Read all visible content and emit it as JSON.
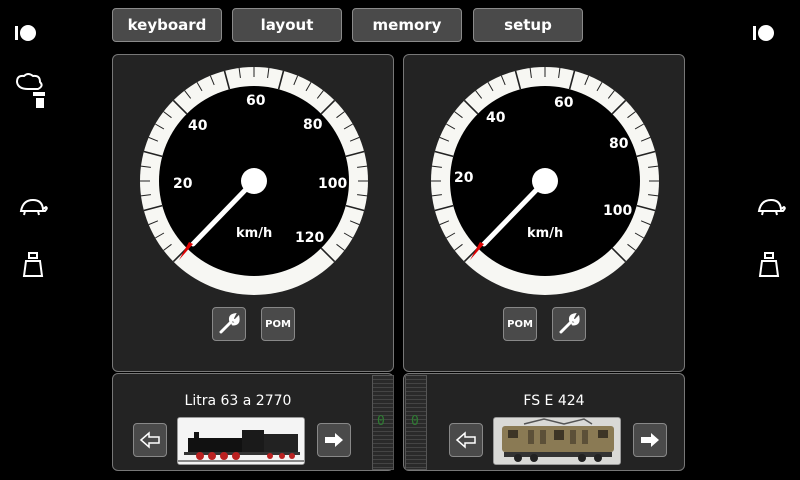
{
  "toolbar": {
    "buttons": [
      {
        "label": "keyboard"
      },
      {
        "label": "layout"
      },
      {
        "label": "memory"
      },
      {
        "label": "setup"
      }
    ]
  },
  "left_side_icons": [
    "power-icon",
    "smoke-icon",
    "turtle-icon",
    "weight-icon"
  ],
  "right_side_icons": [
    "power-icon",
    "turtle-icon",
    "weight-icon"
  ],
  "throttles": [
    {
      "unit": "km/h",
      "speed": 0,
      "tick_labels": [
        "20",
        "40",
        "60",
        "80",
        "100",
        "120"
      ],
      "buttons": [
        "wrench-icon",
        "POM"
      ],
      "loco_name": "Litra 63 a 2770",
      "meter_value": "0"
    },
    {
      "unit": "km/h",
      "speed": 0,
      "tick_labels": [
        "20",
        "40",
        "60",
        "80",
        "100"
      ],
      "buttons": [
        "POM",
        "wrench-icon"
      ],
      "loco_name": "FS E 424",
      "meter_value": "0"
    }
  ],
  "pom_label": "POM",
  "colors": {
    "background": "#000000",
    "panel": "#232323",
    "button": "#4a4a4a",
    "needle_tip": "#e00000",
    "meter_digit": "#2e7d32"
  }
}
